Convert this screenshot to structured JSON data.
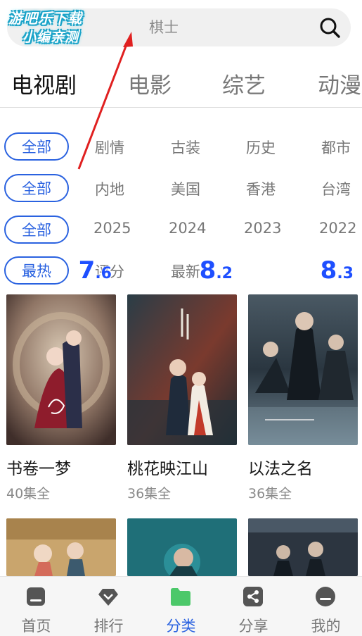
{
  "search": {
    "placeholder": "棋士"
  },
  "watermark": {
    "line1": "游吧乐下载",
    "line2": "小编亲测"
  },
  "main_tabs": [
    {
      "label": "电视剧",
      "active": true
    },
    {
      "label": "电影",
      "active": false
    },
    {
      "label": "综艺",
      "active": false
    },
    {
      "label": "动漫",
      "active": false
    }
  ],
  "filters": {
    "genre": {
      "selected": "全部",
      "options": [
        "剧情",
        "古装",
        "历史",
        "都市"
      ]
    },
    "region": {
      "selected": "全部",
      "options": [
        "内地",
        "美国",
        "香港",
        "台湾"
      ]
    },
    "year": {
      "selected": "全部",
      "options": [
        "2025",
        "2024",
        "2023",
        "2022"
      ]
    },
    "sort": {
      "selected": "最热",
      "options": [
        "评分",
        "最新"
      ]
    }
  },
  "items": [
    {
      "title": "书卷一梦",
      "episodes": "40集全",
      "score_int": "7",
      "score_dec": ".6"
    },
    {
      "title": "桃花映江山",
      "episodes": "36集全",
      "score_int": "8",
      "score_dec": ".2"
    },
    {
      "title": "以法之名",
      "episodes": "36集全",
      "score_int": "8",
      "score_dec": ".3"
    }
  ],
  "bottom_nav": [
    {
      "label": "首页",
      "icon": "home-icon",
      "active": false
    },
    {
      "label": "排行",
      "icon": "diamond-icon",
      "active": false
    },
    {
      "label": "分类",
      "icon": "folder-icon",
      "active": true
    },
    {
      "label": "分享",
      "icon": "share-icon",
      "active": false
    },
    {
      "label": "我的",
      "icon": "profile-icon",
      "active": false
    }
  ],
  "colors": {
    "accent": "#2a62e0",
    "score": "#1e4fff",
    "nav_active_icon": "#4cc86a",
    "annotation_arrow": "#e02020"
  }
}
